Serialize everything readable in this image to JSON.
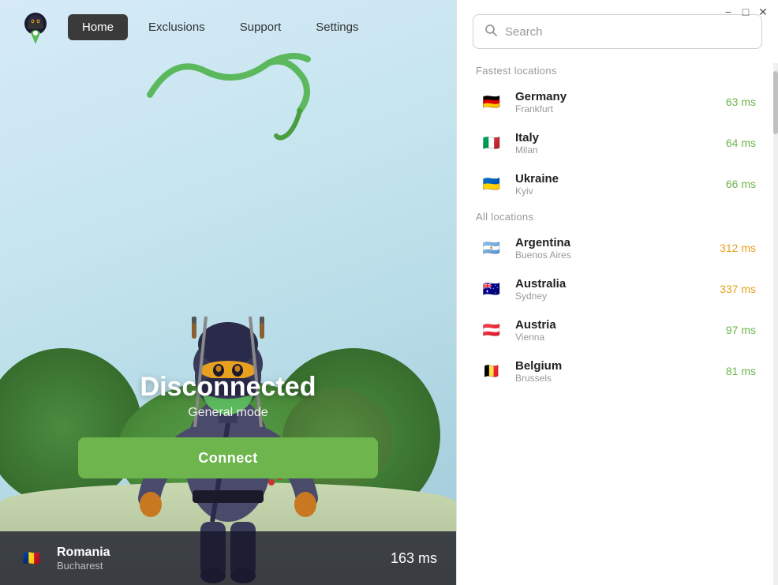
{
  "window": {
    "minimize_label": "−",
    "maximize_label": "□",
    "close_label": "✕"
  },
  "navbar": {
    "home_label": "Home",
    "exclusions_label": "Exclusions",
    "support_label": "Support",
    "settings_label": "Settings"
  },
  "status": {
    "title": "Disconnected",
    "subtitle": "General mode",
    "connect_label": "Connect"
  },
  "current_location": {
    "country": "Romania",
    "city": "Bucharest",
    "ms": "163 ms"
  },
  "search": {
    "placeholder": "Search"
  },
  "fastest_locations": {
    "section_label": "Fastest locations",
    "items": [
      {
        "country": "Germany",
        "city": "Frankfurt",
        "ms": "63 ms",
        "ms_class": "ms-fast",
        "flag": "🇩🇪"
      },
      {
        "country": "Italy",
        "city": "Milan",
        "ms": "64 ms",
        "ms_class": "ms-fast",
        "flag": "🇮🇹"
      },
      {
        "country": "Ukraine",
        "city": "Kyiv",
        "ms": "66 ms",
        "ms_class": "ms-fast",
        "flag": "🇺🇦"
      }
    ]
  },
  "all_locations": {
    "section_label": "All locations",
    "items": [
      {
        "country": "Argentina",
        "city": "Buenos Aires",
        "ms": "312 ms",
        "ms_class": "ms-slow",
        "flag": "🇦🇷"
      },
      {
        "country": "Australia",
        "city": "Sydney",
        "ms": "337 ms",
        "ms_class": "ms-slow",
        "flag": "🇦🇺"
      },
      {
        "country": "Austria",
        "city": "Vienna",
        "ms": "97 ms",
        "ms_class": "ms-fast",
        "flag": "🇦🇹"
      },
      {
        "country": "Belgium",
        "city": "Brussels",
        "ms": "81 ms",
        "ms_class": "ms-fast",
        "flag": "🇧🇪"
      }
    ]
  }
}
